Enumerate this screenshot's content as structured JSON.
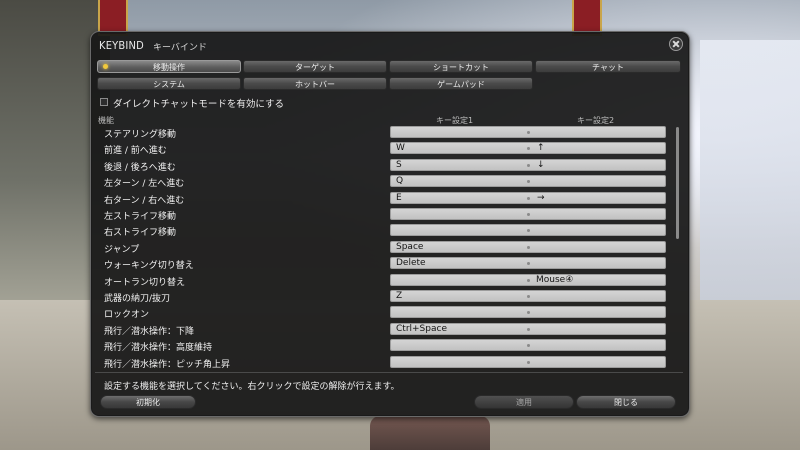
{
  "window": {
    "title": "KEYBIND",
    "subtitle": "キーバインド"
  },
  "tabs_row1": [
    {
      "label": "移動操作",
      "active": true
    },
    {
      "label": "ターゲット"
    },
    {
      "label": "ショートカット"
    },
    {
      "label": "チャット"
    }
  ],
  "tabs_row2": [
    {
      "label": "システム"
    },
    {
      "label": "ホットバー"
    },
    {
      "label": "ゲームパッド"
    }
  ],
  "checkbox_label": "ダイレクトチャットモードを有効にする",
  "columns": {
    "function": "機能",
    "key1": "キー設定1",
    "key2": "キー設定2"
  },
  "rows": [
    {
      "label": "ステアリング移動",
      "key1": "",
      "key2": ""
    },
    {
      "label": "前進 / 前へ進む",
      "key1": "W",
      "key2": "↑"
    },
    {
      "label": "後退 / 後ろへ進む",
      "key1": "S",
      "key2": "↓"
    },
    {
      "label": "左ターン / 左へ進む",
      "key1": "Q",
      "key2": ""
    },
    {
      "label": "右ターン / 右へ進む",
      "key1": "E",
      "key2": "→"
    },
    {
      "label": "左ストライフ移動",
      "key1": "",
      "key2": ""
    },
    {
      "label": "右ストライフ移動",
      "key1": "",
      "key2": ""
    },
    {
      "label": "ジャンプ",
      "key1": "Space",
      "key2": ""
    },
    {
      "label": "ウォーキング切り替え",
      "key1": "Delete",
      "key2": ""
    },
    {
      "label": "オートラン切り替え",
      "key1": "",
      "key2": "Mouse④"
    },
    {
      "label": "武器の納刀/抜刀",
      "key1": "Z",
      "key2": ""
    },
    {
      "label": "ロックオン",
      "key1": "",
      "key2": ""
    },
    {
      "label": "飛行／潜水操作：下降",
      "key1": "Ctrl+Space",
      "key2": ""
    },
    {
      "label": "飛行／潜水操作：高度維持",
      "key1": "",
      "key2": ""
    },
    {
      "label": "飛行／潜水操作：ピッチ角上昇",
      "key1": "",
      "key2": ""
    }
  ],
  "footer": {
    "message": "設定する機能を選択してください。右クリックで設定の解除が行えます。",
    "reset_label": "初期化",
    "apply_label": "適用",
    "close_label": "閉じる"
  },
  "colors": {
    "accent_marker": "#f0c93d",
    "window_bg": "#181818",
    "slot_bg": "#cfcfcf"
  }
}
